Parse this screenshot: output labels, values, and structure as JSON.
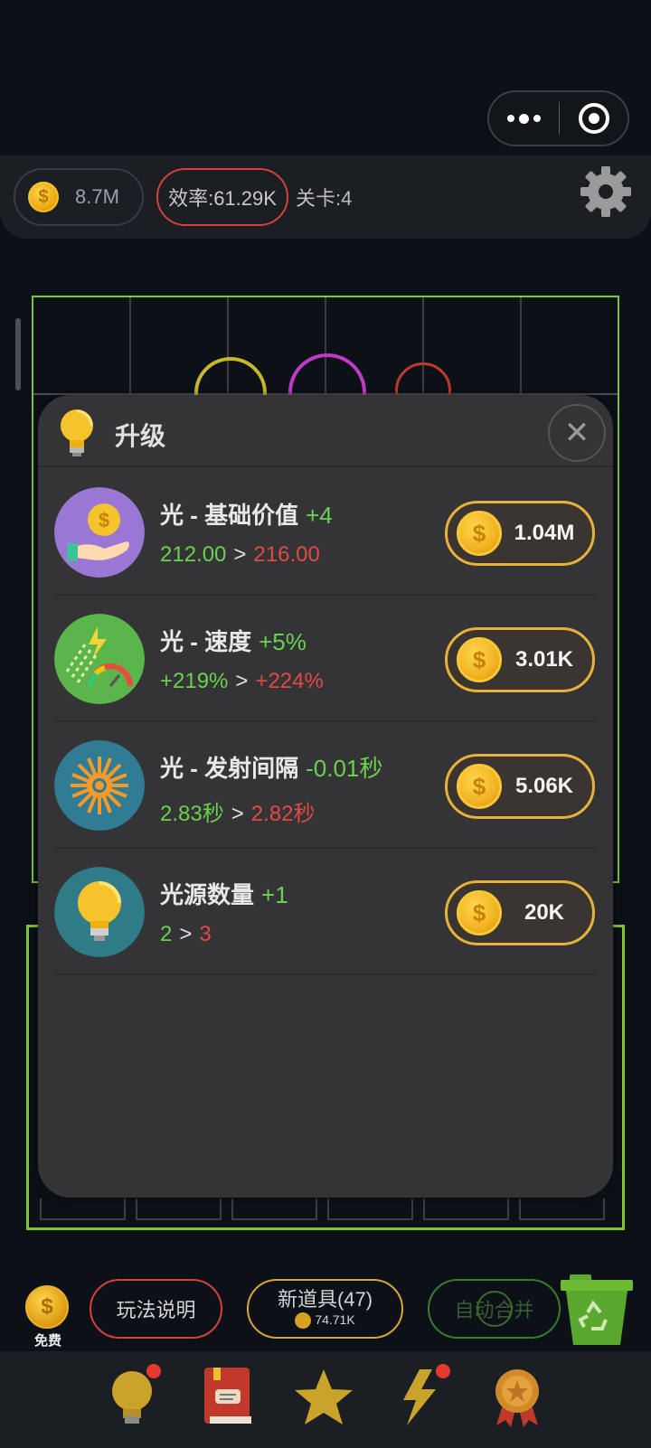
{
  "topbar": {
    "coins": "8.7M",
    "efficiency": "效率:61.29K",
    "level": "关卡:4"
  },
  "dialog": {
    "title": "升级",
    "rows": [
      {
        "name": "光 - 基础价值",
        "inc": "+4",
        "old": "212.00",
        "gt": ">",
        "new": "216.00",
        "price": "1.04M",
        "icon": "coin-hand-icon"
      },
      {
        "name": "光 - 速度",
        "inc": "+5%",
        "old": "+219%",
        "gt": ">",
        "new": "+224%",
        "price": "3.01K",
        "icon": "speed-gauge-icon"
      },
      {
        "name": "光 - 发射间隔",
        "inc": "-0.01秒",
        "old": "2.83秒",
        "gt": ">",
        "new": "2.82秒",
        "price": "5.06K",
        "icon": "sun-icon"
      },
      {
        "name": "光源数量",
        "inc": "+1",
        "old": "2",
        "gt": ">",
        "new": "3",
        "price": "20K",
        "icon": "bulb-icon"
      }
    ]
  },
  "bottom": {
    "free_label": "免费",
    "help": "玩法说明",
    "new_items": "新道具(47)",
    "new_items_cost": "74.71K",
    "auto_merge": "自动合并"
  },
  "colors": {
    "accent_green": "#7cc52e",
    "increase_green": "#6ad14c",
    "new_red": "#e04a44",
    "gold": "#e8b23a"
  }
}
